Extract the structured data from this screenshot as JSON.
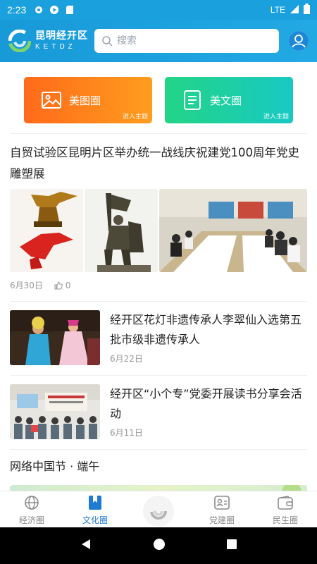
{
  "status_bar": {
    "time": "2:23",
    "network": "LTE",
    "icons": [
      "gear-icon",
      "play-icon",
      "sd-card-icon",
      "signal-icon",
      "battery-icon"
    ]
  },
  "header": {
    "logo_cn": "昆明经开区",
    "logo_en": "KETDZ",
    "search_placeholder": "搜索"
  },
  "circles": [
    {
      "label": "美图圈",
      "sub": "进入主题",
      "icon": "image-icon",
      "color": "#ff7a1a"
    },
    {
      "label": "美文圈",
      "sub": "进入主题",
      "icon": "document-icon",
      "color": "#1fd0a0"
    }
  ],
  "featured_article": {
    "title": "自贸试验区昆明片区举办统一战线庆祝建党100周年党史雕塑展",
    "date": "6月30日",
    "likes": "0"
  },
  "articles": [
    {
      "title": "经开区花灯非遗传承人李翠仙入选第五批市级非遗传承人",
      "date": "6月22日"
    },
    {
      "title": "经开区“小个专”党委开展读书分享会活动",
      "date": "6月11日"
    }
  ],
  "topic": {
    "title": "网络中国节 · 端午"
  },
  "bottom_nav": {
    "items": [
      {
        "label": "经济圈",
        "icon": "globe-icon",
        "active": false
      },
      {
        "label": "文化圈",
        "icon": "bookmark-icon",
        "active": true
      },
      {
        "label": "",
        "icon": "logo-center-icon",
        "active": false
      },
      {
        "label": "党建圈",
        "icon": "id-card-icon",
        "active": false
      },
      {
        "label": "民生圈",
        "icon": "wallet-icon",
        "active": false
      }
    ]
  },
  "colors": {
    "header": "#1aa1dd",
    "accent_active": "#1e7bd1"
  }
}
